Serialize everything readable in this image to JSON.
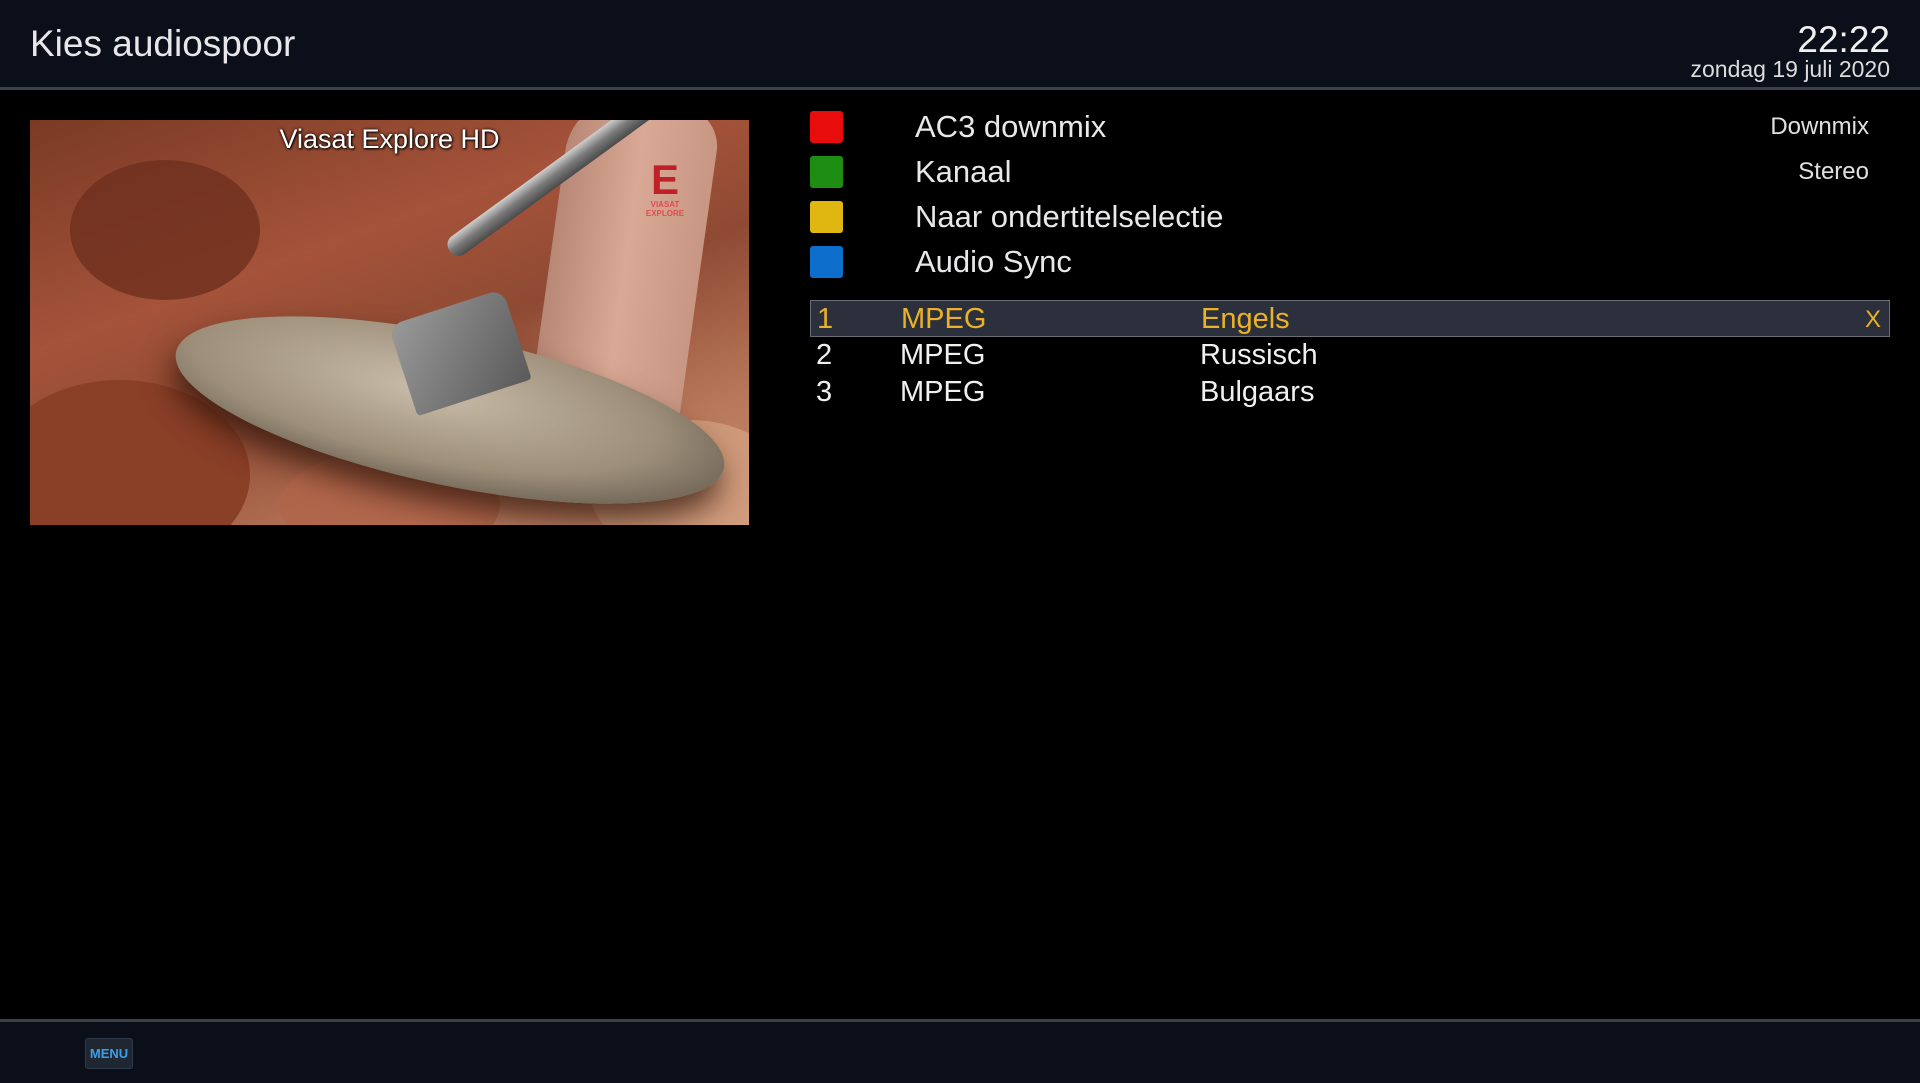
{
  "header": {
    "title": "Kies audiospoor",
    "time": "22:22",
    "date": "zondag 19 juli 2020"
  },
  "preview": {
    "channel_name": "Viasat Explore HD",
    "logo_mark": "E",
    "logo_line1": "VIASAT",
    "logo_line2": "EXPLORE"
  },
  "options": [
    {
      "key_color": "#e80c0c",
      "label": "AC3 downmix",
      "value": "Downmix"
    },
    {
      "key_color": "#1e8e12",
      "label": "Kanaal",
      "value": "Stereo"
    },
    {
      "key_color": "#e0b711",
      "label": "Naar ondertitelselectie",
      "value": ""
    },
    {
      "key_color": "#0e6ecc",
      "label": "Audio Sync",
      "value": ""
    }
  ],
  "tracks": [
    {
      "number": "1",
      "codec": "MPEG",
      "language": "Engels",
      "active_mark": "X"
    },
    {
      "number": "2",
      "codec": "MPEG",
      "language": "Russisch",
      "active_mark": ""
    },
    {
      "number": "3",
      "codec": "MPEG",
      "language": "Bulgaars",
      "active_mark": ""
    }
  ],
  "footer": {
    "menu_key": "MENU"
  },
  "colors": {
    "highlight_text": "#e9b227",
    "menu_key_text": "#3e9fe6"
  }
}
